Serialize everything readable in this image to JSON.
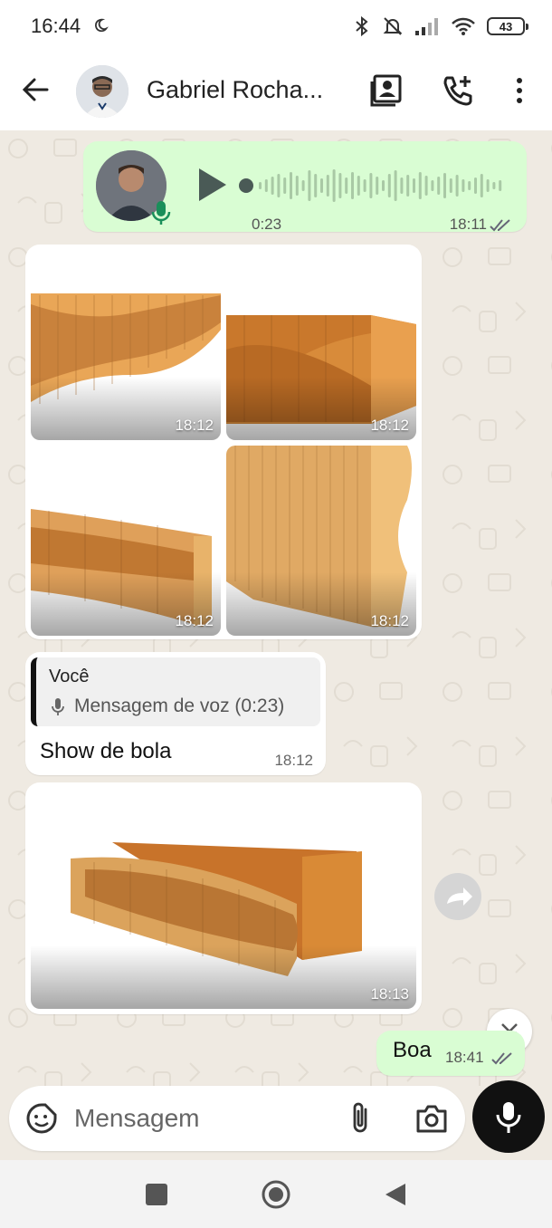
{
  "status_bar": {
    "time": "16:44",
    "battery": "43"
  },
  "header": {
    "contact_name": "Gabriel Rocha..."
  },
  "messages": {
    "voice": {
      "duration": "0:23",
      "time": "18:11"
    },
    "album": {
      "times": [
        "18:12",
        "18:12",
        "18:12",
        "18:12"
      ]
    },
    "reply": {
      "quote_author": "Você",
      "quote_text": "Mensagem de voz (0:23)",
      "text": "Show de bola",
      "time": "18:12"
    },
    "single_photo": {
      "time": "18:13"
    },
    "boa": {
      "text": "Boa",
      "time": "18:41"
    }
  },
  "input": {
    "placeholder": "Mensagem"
  },
  "colors": {
    "outgoing_bubble": "#d9fdd3",
    "incoming_bubble": "#ffffff",
    "chat_bg": "#efeae2",
    "tick_blue": "#53bdeb"
  },
  "icons": [
    "moon-icon",
    "bluetooth-icon",
    "mute-bell-icon",
    "signal-icon",
    "wifi-icon",
    "battery-icon",
    "back-arrow-icon",
    "contact-card-icon",
    "add-call-icon",
    "more-vert-icon",
    "play-icon",
    "mic-icon",
    "forward-icon",
    "chevrons-down-icon",
    "sticker-icon",
    "paperclip-icon",
    "camera-icon",
    "square-icon",
    "circle-icon",
    "triangle-back-icon"
  ]
}
